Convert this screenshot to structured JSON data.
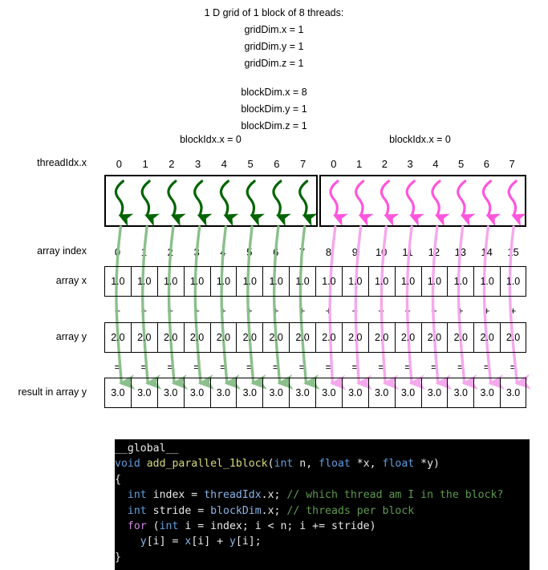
{
  "header": {
    "lines": [
      "1 D grid of 1 block of 8 threads:",
      "gridDim.x = 1",
      "gridDim.y = 1",
      "gridDim.z = 1"
    ],
    "lines2": [
      "blockDim.x = 8",
      "blockDim.y = 1",
      "blockDim.z = 1"
    ]
  },
  "blocks": [
    {
      "label": "blockIdx.x = 0",
      "color": "#006400",
      "thread_ids": [
        "0",
        "1",
        "2",
        "3",
        "4",
        "5",
        "6",
        "7"
      ]
    },
    {
      "label": "blockIdx.x = 0",
      "color": "#ff55dd",
      "thread_ids": [
        "0",
        "1",
        "2",
        "3",
        "4",
        "5",
        "6",
        "7"
      ]
    }
  ],
  "labels": {
    "threadidx": "threadIdx.x",
    "array_index": "array index",
    "array_x": "array x",
    "array_y": "array y",
    "result": "result in array y"
  },
  "array": {
    "indices": [
      "0",
      "1",
      "2",
      "3",
      "4",
      "5",
      "6",
      "7",
      "8",
      "9",
      "10",
      "11",
      "12",
      "13",
      "14",
      "15"
    ],
    "x_values": [
      "1.0",
      "1.0",
      "1.0",
      "1.0",
      "1.0",
      "1.0",
      "1.0",
      "1.0",
      "1.0",
      "1.0",
      "1.0",
      "1.0",
      "1.0",
      "1.0",
      "1.0",
      "1.0"
    ],
    "y_values": [
      "2.0",
      "2.0",
      "2.0",
      "2.0",
      "2.0",
      "2.0",
      "2.0",
      "2.0",
      "2.0",
      "2.0",
      "2.0",
      "2.0",
      "2.0",
      "2.0",
      "2.0",
      "2.0"
    ],
    "result_values": [
      "3.0",
      "3.0",
      "3.0",
      "3.0",
      "3.0",
      "3.0",
      "3.0",
      "3.0",
      "3.0",
      "3.0",
      "3.0",
      "3.0",
      "3.0",
      "3.0",
      "3.0",
      "3.0"
    ],
    "plus_ops": [
      "+",
      "+",
      "+",
      "+",
      "+",
      "+",
      "+",
      "+",
      "+",
      "+",
      "+",
      "+",
      "+",
      "+",
      "+",
      "+"
    ],
    "equal_ops": [
      "=",
      "=",
      "=",
      "=",
      "=",
      "=",
      "=",
      "=",
      "=",
      "=",
      "=",
      "=",
      "=",
      "=",
      "=",
      "="
    ]
  },
  "colors": {
    "green_arrow": "#006400",
    "pink_arrow": "#ff55dd",
    "green_flow": "#8bbf8b",
    "pink_flow": "#f5a8ec",
    "code_background": "#000000",
    "code_keyword": "#5f9fe0",
    "code_control": "#cc88dd",
    "code_function": "#d8d87a",
    "code_variable": "#8ab4e8",
    "code_comment": "#5f9a4f"
  },
  "code": {
    "language": "cuda-c",
    "raw": "__global__\nvoid add_parallel_1block(int n, float *x, float *y)\n{\n  int index = threadIdx.x; // which thread am I in the block?\n  int stride = blockDim.x; // threads per block\n  for (int i = index; i < n; i += stride)\n    y[i] = x[i] + y[i];\n}"
  }
}
